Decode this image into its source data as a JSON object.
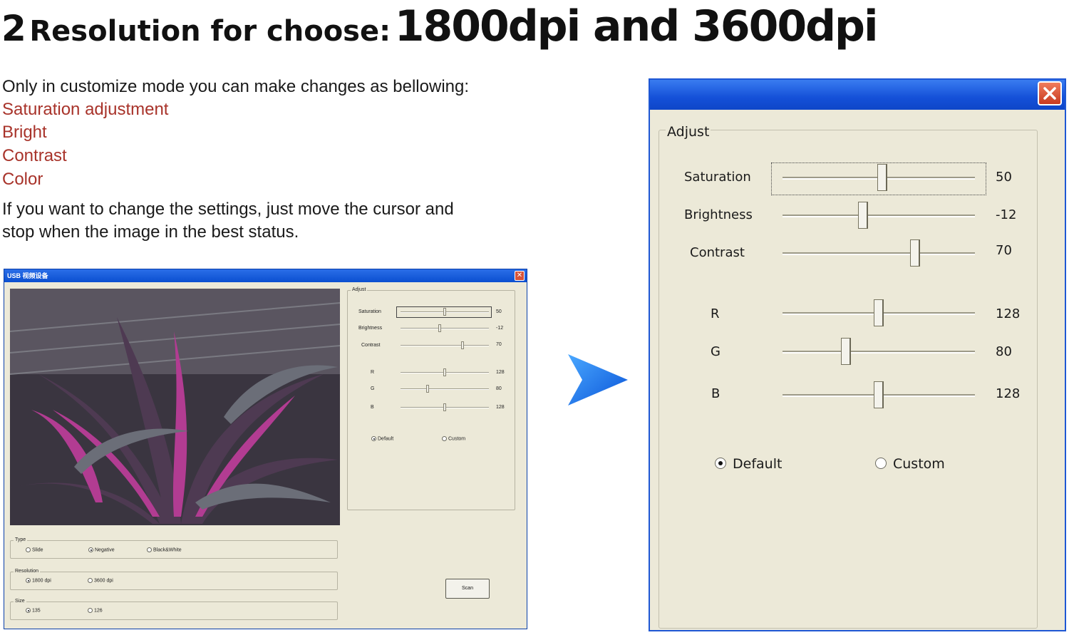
{
  "heading": {
    "prefix": "2",
    "middle": "Resolution for choose:",
    "suffix": "1800dpi and 3600dpi"
  },
  "description": {
    "intro": "Only in customize mode you can make changes as bellowing:",
    "items": [
      "Saturation adjustment",
      "Bright",
      "Contrast",
      "Color"
    ],
    "outro_line1": "If you want to change the settings, just move the cursor and",
    "outro_line2": "stop when the image in the best status."
  },
  "small_window": {
    "title": "USB 视频设备",
    "adjust_label": "Adjust",
    "sliders": [
      {
        "label": "Saturation",
        "value": "50",
        "fraction": 0.5
      },
      {
        "label": "Brightness",
        "value": "-12",
        "fraction": 0.44
      },
      {
        "label": "Contrast",
        "value": "70",
        "fraction": 0.7
      },
      {
        "label": "R",
        "value": "128",
        "fraction": 0.5
      },
      {
        "label": "G",
        "value": "80",
        "fraction": 0.31
      },
      {
        "label": "B",
        "value": "128",
        "fraction": 0.5
      }
    ],
    "mode": {
      "default": "Default",
      "custom": "Custom",
      "selected": "Default"
    },
    "type": {
      "label": "Type",
      "options": [
        "Slide",
        "Negative",
        "Black&White"
      ],
      "selected": "Negative"
    },
    "resolution": {
      "label": "Resolution",
      "options": [
        "1800 dpi",
        "3600 dpi"
      ],
      "selected": "1800 dpi"
    },
    "size": {
      "label": "Size",
      "options": [
        "135",
        "126"
      ],
      "selected": "135"
    },
    "scan_button": "Scan"
  },
  "large_window": {
    "adjust_label": "Adjust",
    "sliders": [
      {
        "label": "Saturation",
        "value": "50",
        "fraction": 0.52
      },
      {
        "label": "Brightness",
        "value": "-12",
        "fraction": 0.42
      },
      {
        "label": "Contrast",
        "value": "70",
        "fraction": 0.69
      },
      {
        "label": "R",
        "value": "128",
        "fraction": 0.5
      },
      {
        "label": "G",
        "value": "80",
        "fraction": 0.33
      },
      {
        "label": "B",
        "value": "128",
        "fraction": 0.5
      }
    ],
    "mode": {
      "default": "Default",
      "custom": "Custom",
      "selected": "Default"
    }
  },
  "colors": {
    "accent_red": "#a8332a",
    "titlebar_blue": "#1450d8",
    "dialog_bg": "#ece9d8",
    "arrow_blue": "#1f6ff0"
  },
  "icons": [
    "close-icon",
    "arrow-right-icon",
    "photo-plant"
  ]
}
